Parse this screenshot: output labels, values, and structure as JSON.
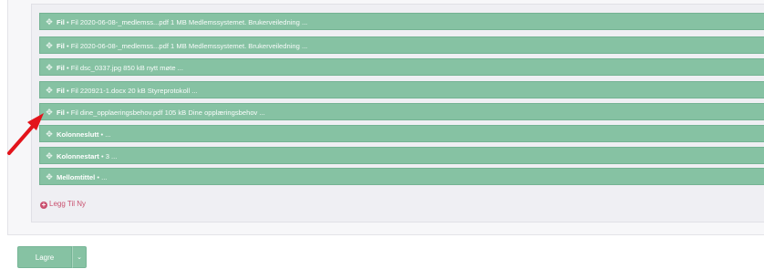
{
  "items": [
    {
      "type": "Fil",
      "desc": " • Fil 2020-06-08-_medlemss...pdf 1 MB Medlemssystemet. Brukerveiledning ..."
    },
    {
      "type": "Fil",
      "desc": " • Fil 2020-06-08-_medlemss...pdf 1 MB Medlemssystemet. Brukerveiledning ..."
    },
    {
      "type": "Fil",
      "desc": " • Fil dsc_0337.jpg 850 kB nytt møte ..."
    },
    {
      "type": "Fil",
      "desc": " • Fil 220921-1.docx 20 kB Styreprotokoll ..."
    },
    {
      "type": "Fil",
      "desc": " • Fil dine_opplaeringsbehov.pdf 105 kB Dine opplæringsbehov ..."
    },
    {
      "type": "Kolonneslutt",
      "desc": " • ..."
    },
    {
      "type": "Kolonnestart",
      "desc": " • 3 ..."
    },
    {
      "type": "Mellomtittel",
      "desc": " • ..."
    }
  ],
  "add_new_label": "Legg Til Ny",
  "save_label": "Lagre",
  "icons": {
    "move": "move-icon",
    "add": "plus-circle-icon",
    "caret": "chevron-down-icon",
    "annotation": "red-arrow-icon"
  },
  "colors": {
    "item_bg": "#86c2a3",
    "add_link": "#c9506f",
    "annotation_arrow": "#e3141b"
  }
}
